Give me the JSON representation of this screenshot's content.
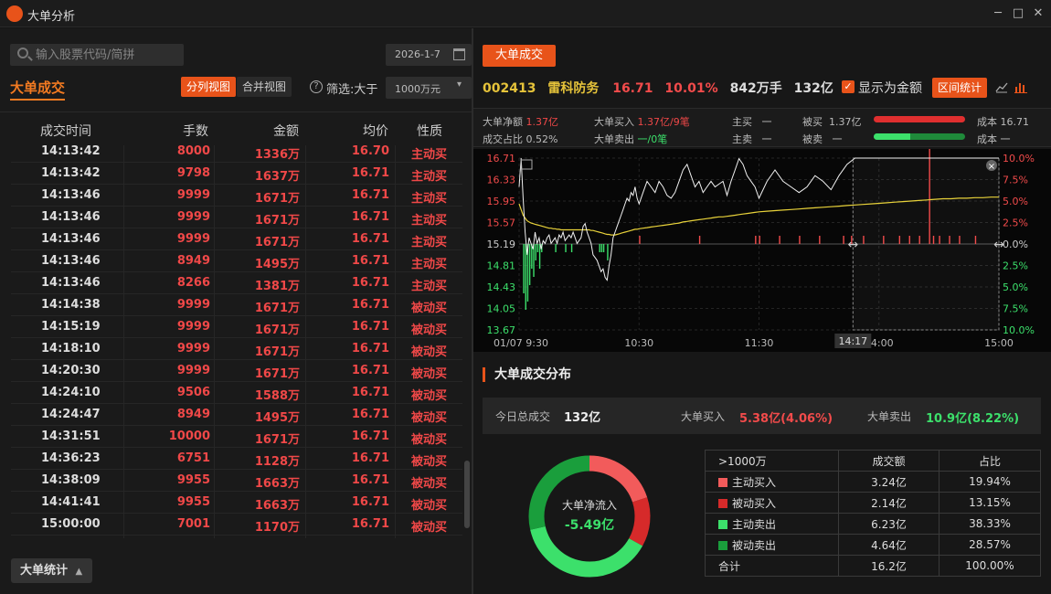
{
  "window": {
    "title": "大单分析",
    "controls": [
      "─",
      "□",
      "✕"
    ]
  },
  "left": {
    "search_placeholder": "输入股票代码/简拼",
    "date": "2026-1-7",
    "tab_label": "大单成交",
    "view_split": "分列视图",
    "view_merge": "合并视图",
    "filter_label": "筛选:大于",
    "filter_value": "1000万元",
    "columns": [
      "成交时间",
      "手数",
      "金额",
      "均价",
      "性质"
    ],
    "rows": [
      {
        "time": "14:13:42",
        "qty": "8000",
        "amt": "1336万",
        "price": "16.70",
        "type": "主动买"
      },
      {
        "time": "14:13:42",
        "qty": "9798",
        "amt": "1637万",
        "price": "16.71",
        "type": "主动买"
      },
      {
        "time": "14:13:46",
        "qty": "9999",
        "amt": "1671万",
        "price": "16.71",
        "type": "主动买"
      },
      {
        "time": "14:13:46",
        "qty": "9999",
        "amt": "1671万",
        "price": "16.71",
        "type": "主动买"
      },
      {
        "time": "14:13:46",
        "qty": "9999",
        "amt": "1671万",
        "price": "16.71",
        "type": "主动买"
      },
      {
        "time": "14:13:46",
        "qty": "8949",
        "amt": "1495万",
        "price": "16.71",
        "type": "主动买"
      },
      {
        "time": "14:13:46",
        "qty": "8266",
        "amt": "1381万",
        "price": "16.71",
        "type": "主动买"
      },
      {
        "time": "14:14:38",
        "qty": "9999",
        "amt": "1671万",
        "price": "16.71",
        "type": "被动买"
      },
      {
        "time": "14:15:19",
        "qty": "9999",
        "amt": "1671万",
        "price": "16.71",
        "type": "被动买"
      },
      {
        "time": "14:18:10",
        "qty": "9999",
        "amt": "1671万",
        "price": "16.71",
        "type": "被动买"
      },
      {
        "time": "14:20:30",
        "qty": "9999",
        "amt": "1671万",
        "price": "16.71",
        "type": "被动买"
      },
      {
        "time": "14:24:10",
        "qty": "9506",
        "amt": "1588万",
        "price": "16.71",
        "type": "被动买"
      },
      {
        "time": "14:24:47",
        "qty": "8949",
        "amt": "1495万",
        "price": "16.71",
        "type": "被动买"
      },
      {
        "time": "14:31:51",
        "qty": "10000",
        "amt": "1671万",
        "price": "16.71",
        "type": "被动买"
      },
      {
        "time": "14:36:23",
        "qty": "6751",
        "amt": "1128万",
        "price": "16.71",
        "type": "被动买"
      },
      {
        "time": "14:38:09",
        "qty": "9955",
        "amt": "1663万",
        "price": "16.71",
        "type": "被动买"
      },
      {
        "time": "14:41:41",
        "qty": "9955",
        "amt": "1663万",
        "price": "16.71",
        "type": "被动买"
      },
      {
        "time": "15:00:00",
        "qty": "7001",
        "amt": "1170万",
        "price": "16.71",
        "type": "被动买"
      }
    ],
    "stats_button": "大单统计"
  },
  "right": {
    "tab_label": "大单成交",
    "stock": {
      "code": "002413",
      "name": "雷科防务",
      "price": "16.71",
      "pct": "10.01%",
      "vol": "842万手",
      "amt": "132亿"
    },
    "show_amount_label": "显示为金额",
    "interval_button": "区间统计",
    "stats": {
      "net_label": "大单净额",
      "net_value": "1.37亿",
      "ratio_label": "成交占比",
      "ratio_value": "0.52%",
      "buy_label": "大单买入",
      "buy_value": "1.37亿/9笔",
      "sell_label": "大单卖出",
      "sell_value": "一/0笔",
      "active_buy_label": "主买",
      "active_buy_value": "一",
      "active_sell_label": "主卖",
      "active_sell_value": "一",
      "passive_buy_label": "被买",
      "passive_buy_value": "1.37亿",
      "passive_sell_label": "被卖",
      "passive_sell_value": "一",
      "cost_label": "成本",
      "cost_buy_value": "16.71",
      "cost_sell_value": "一",
      "buy_bar_fraction": 1.0,
      "sell_bar_fraction": 0.4
    },
    "chart_data": {
      "type": "line",
      "y_left_ticks": [
        "16.71",
        "16.33",
        "15.95",
        "15.57",
        "15.19",
        "14.81",
        "14.43",
        "14.05",
        "13.67"
      ],
      "y_right_ticks": [
        "10.0%",
        "7.5%",
        "5.0%",
        "2.5%",
        "0.0%",
        "2.5%",
        "5.0%",
        "7.5%",
        "10.0%"
      ],
      "x_ticks": [
        "01/07 9:30",
        "10:30",
        "11:30",
        "14:00",
        "15:00"
      ],
      "selection_start_label": "14:17",
      "prev_close": 15.19,
      "ylim": [
        13.67,
        16.71
      ],
      "x_minutes": [
        0,
        1,
        2,
        3,
        4,
        5,
        6,
        7,
        8,
        9,
        10,
        11,
        12,
        13,
        14,
        15,
        16,
        17,
        18,
        19,
        20,
        21,
        22,
        23,
        24,
        25,
        26,
        27,
        28,
        29,
        30,
        31,
        32,
        33,
        34,
        35,
        36,
        37,
        38,
        39,
        40,
        41,
        42,
        43,
        44,
        45,
        46,
        47,
        48,
        49,
        50,
        51,
        52,
        53,
        54,
        55,
        56,
        57,
        58,
        59,
        60,
        62,
        64,
        66,
        68,
        70,
        72,
        74,
        76,
        78,
        80,
        82,
        84,
        86,
        88,
        90,
        92,
        94,
        96,
        98,
        100,
        102,
        104,
        106,
        108,
        110,
        112,
        114,
        116,
        118,
        120,
        124,
        128,
        132,
        136,
        140,
        144,
        148,
        152,
        156,
        160,
        164,
        168,
        172,
        176,
        180,
        184,
        188,
        192,
        196,
        200,
        204,
        208,
        212,
        216,
        220,
        224,
        228,
        232,
        236,
        240
      ],
      "price": [
        16.2,
        16.71,
        16.0,
        15.4,
        15.0,
        15.3,
        15.2,
        15.1,
        15.4,
        15.2,
        15.3,
        15.1,
        15.25,
        15.2,
        15.3,
        15.35,
        15.2,
        15.25,
        15.3,
        15.2,
        15.35,
        15.3,
        15.4,
        15.25,
        15.3,
        15.35,
        15.3,
        15.4,
        15.3,
        15.2,
        15.25,
        15.3,
        15.5,
        15.55,
        15.4,
        15.3,
        15.2,
        15.0,
        14.95,
        14.9,
        14.8,
        14.7,
        14.75,
        14.6,
        14.55,
        14.8,
        15.0,
        15.3,
        15.4,
        15.5,
        15.6,
        15.7,
        15.8,
        15.9,
        16.0,
        15.95,
        16.1,
        16.05,
        16.2,
        16.0,
        15.9,
        16.1,
        16.3,
        16.2,
        16.1,
        16.3,
        16.2,
        16.05,
        16.0,
        16.1,
        16.3,
        16.5,
        16.6,
        16.4,
        16.2,
        16.3,
        16.1,
        16.2,
        16.3,
        16.2,
        16.25,
        16.3,
        16.05,
        16.3,
        16.5,
        16.7,
        16.6,
        16.4,
        16.3,
        16.2,
        16.0,
        16.3,
        16.5,
        16.3,
        16.2,
        16.1,
        16.2,
        16.4,
        16.3,
        16.15,
        16.4,
        16.6,
        16.71,
        16.71,
        16.71,
        16.71,
        16.71,
        16.71,
        16.71,
        16.71,
        16.71,
        16.71,
        16.71,
        16.71,
        16.71,
        16.71,
        16.71,
        16.71,
        16.71,
        16.71,
        16.71,
        16.71,
        16.71
      ],
      "avg": [
        15.9,
        15.8,
        15.7,
        15.65,
        15.6,
        15.58,
        15.56,
        15.55,
        15.54,
        15.53,
        15.52,
        15.51,
        15.5,
        15.49,
        15.48,
        15.47,
        15.47,
        15.46,
        15.46,
        15.45,
        15.45,
        15.44,
        15.44,
        15.44,
        15.44,
        15.44,
        15.44,
        15.44,
        15.44,
        15.44,
        15.44,
        15.44,
        15.44,
        15.44,
        15.44,
        15.44,
        15.43,
        15.43,
        15.42,
        15.41,
        15.4,
        15.39,
        15.38,
        15.37,
        15.36,
        15.36,
        15.35,
        15.35,
        15.35,
        15.36,
        15.37,
        15.38,
        15.39,
        15.4,
        15.41,
        15.42,
        15.43,
        15.44,
        15.45,
        15.45,
        15.46,
        15.47,
        15.48,
        15.49,
        15.5,
        15.51,
        15.52,
        15.53,
        15.54,
        15.55,
        15.56,
        15.58,
        15.59,
        15.6,
        15.61,
        15.62,
        15.63,
        15.64,
        15.65,
        15.66,
        15.67,
        15.67,
        15.68,
        15.69,
        15.7,
        15.71,
        15.72,
        15.73,
        15.74,
        15.75,
        15.76,
        15.77,
        15.78,
        15.79,
        15.8,
        15.81,
        15.82,
        15.83,
        15.84,
        15.85,
        15.86,
        15.87,
        15.88,
        15.89,
        15.9,
        15.91,
        15.92,
        15.93,
        15.94,
        15.95,
        15.96,
        15.97,
        15.98,
        15.99,
        15.99,
        16.0,
        16.0,
        16.01,
        16.01,
        16.02,
        16.02
      ],
      "bars_minutes": [
        2,
        3,
        4,
        5,
        6,
        7,
        8,
        9,
        10,
        11,
        18,
        23,
        26,
        40,
        41,
        42,
        44,
        60,
        90,
        118,
        120,
        130,
        140,
        150,
        162,
        166,
        172,
        182,
        190,
        195,
        200,
        205,
        207,
        210,
        215,
        220,
        228
      ],
      "bars_value": [
        -6,
        -8,
        -7,
        -5,
        -3,
        -4,
        -2,
        -1,
        -3,
        -1,
        -1,
        -1,
        -1,
        -1,
        -1,
        -1,
        -2,
        1,
        1,
        1,
        1,
        1,
        1,
        1,
        1,
        1,
        1,
        1,
        1,
        1,
        1,
        12,
        1,
        1,
        1,
        1,
        1
      ]
    },
    "dist_title": "大单成交分布",
    "summary": {
      "total_label": "今日总成交",
      "total_value": "132亿",
      "buy_label": "大单买入",
      "buy_value": "5.38亿(4.06%)",
      "sell_label": "大单卖出",
      "sell_value": "10.9亿(8.22%)"
    },
    "donut": {
      "label": "大单净流入",
      "value": "-5.49亿"
    },
    "dist_table": {
      "headers": [
        ">1000万",
        "成交额",
        "占比"
      ],
      "rows": [
        {
          "name": "主动买入",
          "amt": "3.24亿",
          "pct": "19.94%",
          "color": "#f25b5b",
          "share": 19.94
        },
        {
          "name": "被动买入",
          "amt": "2.14亿",
          "pct": "13.15%",
          "color": "#d62a2a",
          "share": 13.15
        },
        {
          "name": "主动卖出",
          "amt": "6.23亿",
          "pct": "38.33%",
          "color": "#3ce06b",
          "share": 38.33
        },
        {
          "name": "被动卖出",
          "amt": "4.64亿",
          "pct": "28.57%",
          "color": "#1a9e3c",
          "share": 28.57
        }
      ],
      "total_label": "合计",
      "total_amt": "16.2亿",
      "total_pct": "100.00%"
    }
  }
}
